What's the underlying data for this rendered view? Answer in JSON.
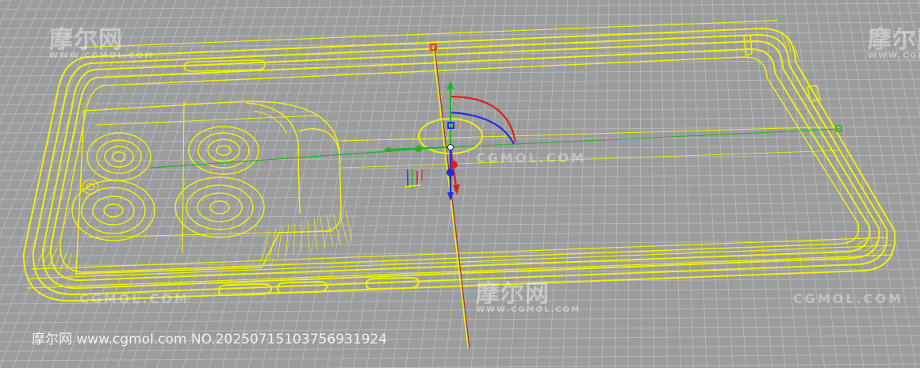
{
  "viewport": {
    "background_color": "#9a9c9e",
    "grid_color": "#b5b7b9",
    "wireframe_color": "#f2f200",
    "gizmo_colors": {
      "x": "#e02020",
      "y": "#1fb41f",
      "z": "#2030e0"
    }
  },
  "watermarks": {
    "logo_text": "摩尔网",
    "logo_subtext": "WWW.CGMOL.COM",
    "url_text": "CGMOL.COM"
  },
  "footer": {
    "text": "摩尔网 www.cgmol.com NO.20250715103756931924"
  },
  "icons": [
    "gizmo-icon",
    "axis-triad-icon"
  ]
}
